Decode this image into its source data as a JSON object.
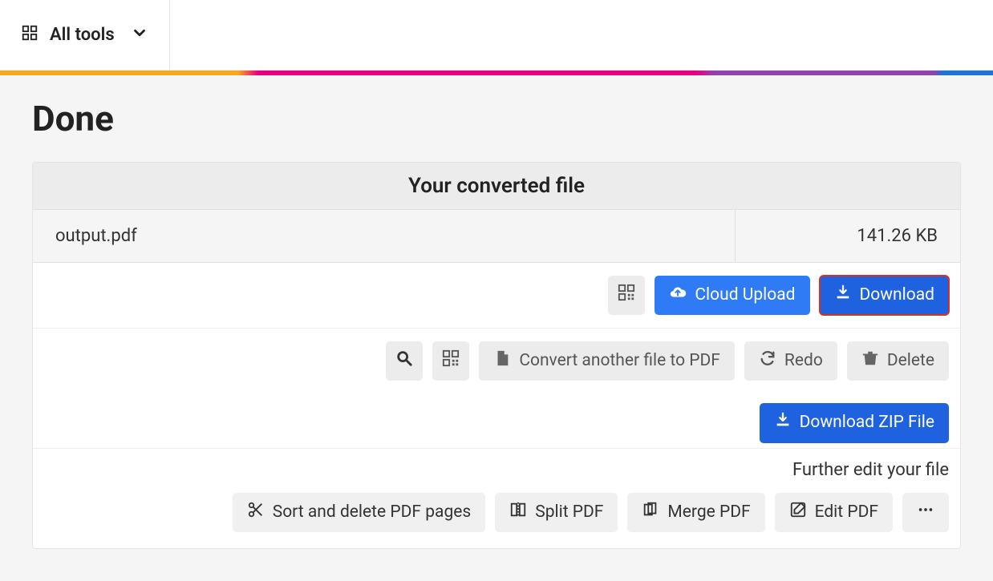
{
  "header": {
    "allToolsLabel": "All tools"
  },
  "page": {
    "title": "Done",
    "panelTitle": "Your converted file",
    "file": {
      "name": "output.pdf",
      "size": "141.26 KB"
    },
    "actions": {
      "cloudUpload": "Cloud Upload",
      "download": "Download",
      "convertAnother": "Convert another file to PDF",
      "redo": "Redo",
      "delete": "Delete",
      "downloadZip": "Download ZIP File"
    },
    "furtherEdit": "Further edit your file",
    "edit": {
      "sortDelete": "Sort and delete PDF pages",
      "split": "Split PDF",
      "merge": "Merge PDF",
      "editPdf": "Edit PDF"
    }
  }
}
